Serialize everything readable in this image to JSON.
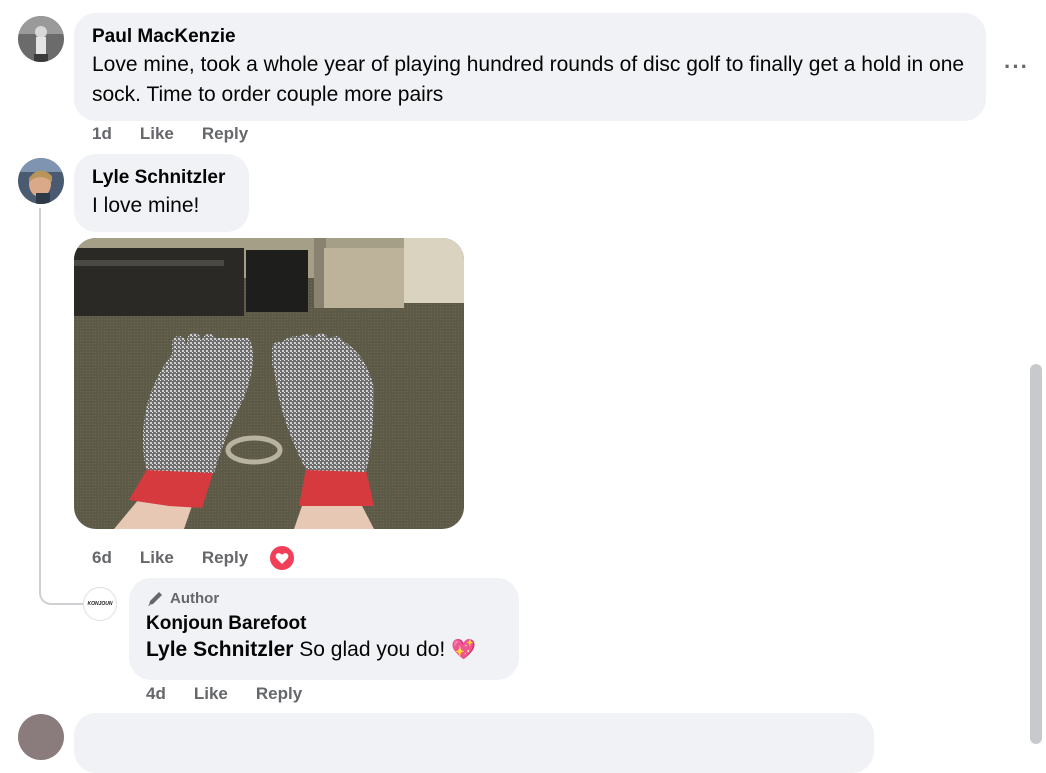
{
  "comments": [
    {
      "author": "Paul MacKenzie",
      "text": "Love mine, took a whole year of playing hundred rounds of disc golf to finally get a hold in one sock. Time to order couple more pairs",
      "time": "1d",
      "like": "Like",
      "reply": "Reply",
      "more": "···"
    },
    {
      "author": "Lyle Schnitzler",
      "text": "I love mine!",
      "time": "6d",
      "like": "Like",
      "reply": "Reply",
      "reaction_icon": "heart-reaction-icon",
      "image_alt": "Grey toe socks with red cuffs on feet"
    }
  ],
  "reply": {
    "badge": "Author",
    "badge_icon": "pencil-icon",
    "author": "Konjoun Barefoot",
    "avatar_text": "KONJOUN",
    "mention": "Lyle Schnitzler",
    "text": "So glad you do!",
    "emoji": "💖",
    "time": "4d",
    "like": "Like",
    "reply": "Reply"
  },
  "colors": {
    "bubble": "#f0f2f5",
    "muted": "#65676b",
    "heart": "#f33e58"
  }
}
